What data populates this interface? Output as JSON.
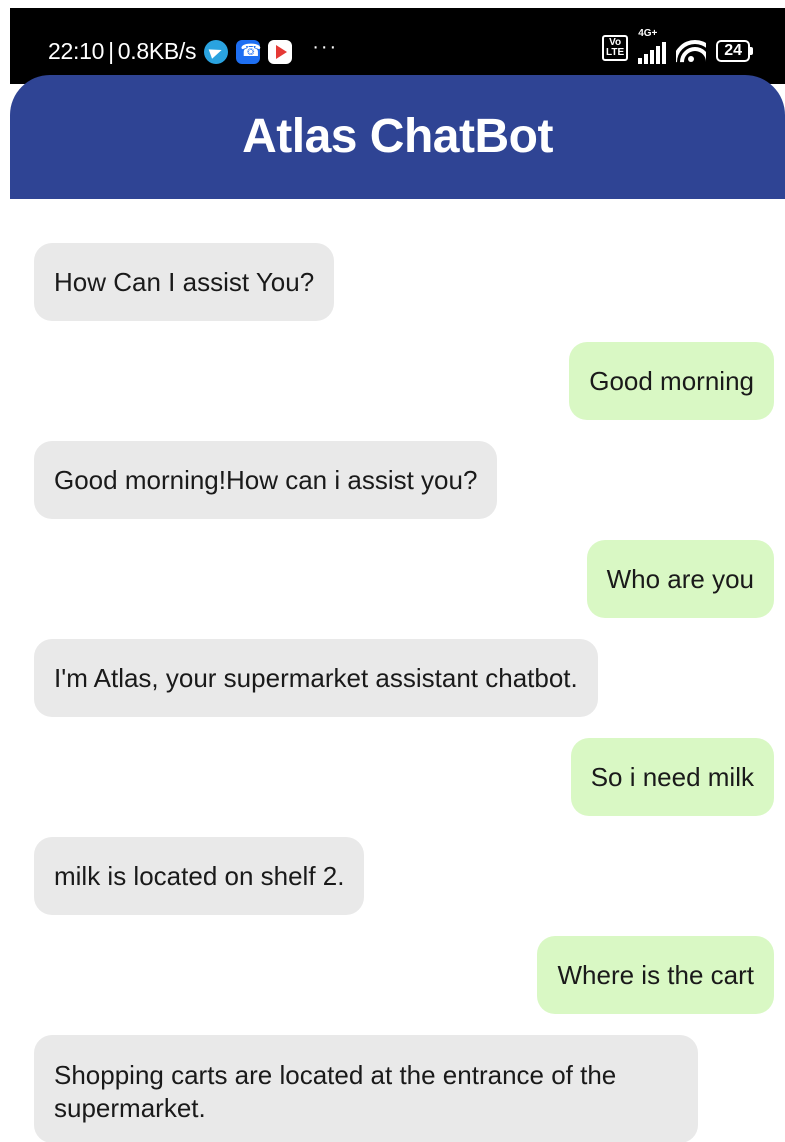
{
  "status_bar": {
    "time": "22:10",
    "speed": "0.8KB/s",
    "separator": "|",
    "more_dots": "···",
    "volte": "Vo\nLTE",
    "network": "4G+",
    "battery": "24",
    "icons": [
      "telegram-icon",
      "phone-icon",
      "play-icon",
      "volte-icon",
      "signal-icon",
      "wifi-icon",
      "battery-icon"
    ]
  },
  "header": {
    "title": "Atlas ChatBot",
    "color": "#2f4494"
  },
  "messages": [
    {
      "sender": "bot",
      "text": "How Can I assist You?"
    },
    {
      "sender": "user",
      "text": "Good morning"
    },
    {
      "sender": "bot",
      "text": "Good morning!How can i assist you?"
    },
    {
      "sender": "user",
      "text": "Who are you"
    },
    {
      "sender": "bot",
      "text": "I'm Atlas, your supermarket assistant chatbot."
    },
    {
      "sender": "user",
      "text": "So i need milk"
    },
    {
      "sender": "bot",
      "text": "milk is located on shelf 2."
    },
    {
      "sender": "user",
      "text": "Where is the cart"
    },
    {
      "sender": "bot",
      "text": "Shopping carts are located at the entrance of the supermarket."
    }
  ],
  "colors": {
    "bot_bubble": "#e9e9e9",
    "user_bubble": "#d9f8c4"
  }
}
